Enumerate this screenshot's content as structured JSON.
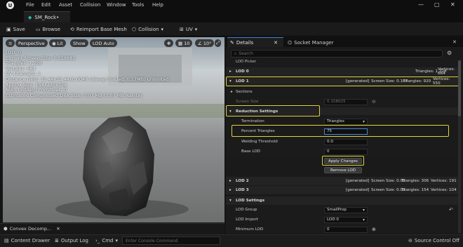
{
  "menu": [
    "File",
    "Edit",
    "Asset",
    "Collision",
    "Window",
    "Tools",
    "Help"
  ],
  "document_tab": "SM_Rock•",
  "toolbar": {
    "save": "Save",
    "browse": "Browse",
    "reimport": "Reimport Base Mesh",
    "collision": "Collision",
    "uv": "UV"
  },
  "viewport": {
    "perspective": "Perspective",
    "lit": "Lit",
    "show": "Show",
    "lod": "LOD Auto",
    "grid_value": "10",
    "angle_value": "10°",
    "stats": [
      "LOD: 0",
      "Current Screen Size: 0.558882",
      "Triangles: 1,228",
      "Vertices: 664",
      "UV Channels: 1",
      "Distance Field: 35.44x35.44x0.0048 (always loaded: 0.17MB) unlimited",
      "Approx Size: 154x235x226",
      "Num Collision Primitives: 0",
      "Estimated Compressed Disk Size: 0.07 MB (0.07 MB Nanite)"
    ]
  },
  "bottom": {
    "convex_tab": "Convex Decomp...",
    "content_drawer": "Content Drawer",
    "output_log": "Output Log",
    "cmd": "Cmd",
    "console_placeholder": "Enter Console Command",
    "source_control": "Source Control Off"
  },
  "details": {
    "tab": "Details",
    "socket_tab": "Socket Manager",
    "search_placeholder": "Search",
    "lod_picker": "LOD Picker",
    "lod0": {
      "label": "LOD 0",
      "triangles": "Triangles: 1,228",
      "vertices": "Vertices: 664"
    },
    "lod1": {
      "label": "LOD 1",
      "generated": "[generated]",
      "screen": "Screen Size: 0.167",
      "triangles": "Triangles: 920",
      "vertices": "Vertices: 550"
    },
    "sections": "Sections",
    "screen_size": {
      "label": "Screen Size",
      "value": "0.158025"
    },
    "reduction": "Reduction Settings",
    "termination": {
      "label": "Termination",
      "value": "Triangles"
    },
    "percent": {
      "label": "Percent Triangles",
      "value": "75"
    },
    "welding": {
      "label": "Welding Threshold",
      "value": "0.0"
    },
    "base_lod": {
      "label": "Base LOD",
      "value": "0"
    },
    "apply": "Apply Changes",
    "remove": "Remove LOD",
    "lod2": {
      "label": "LOD 2",
      "generated": "[generated]",
      "screen": "Screen Size: 0.05",
      "triangles": "Triangles: 306",
      "vertices": "Vertices: 191"
    },
    "lod3": {
      "label": "LOD 3",
      "generated": "[generated]",
      "screen": "Screen Size: 0.03",
      "triangles": "Triangles: 154",
      "vertices": "Vertices: 104"
    },
    "lod_settings": "LOD Settings",
    "lod_group": {
      "label": "LOD Group",
      "value": "SmallProp"
    },
    "lod_import": {
      "label": "LOD Import",
      "value": "LOD 0"
    },
    "min_lod": {
      "label": "Minimum LOD",
      "value": "0"
    }
  },
  "colors": {
    "highlight": "#e3d33a",
    "accent": "#3f7fd0"
  }
}
